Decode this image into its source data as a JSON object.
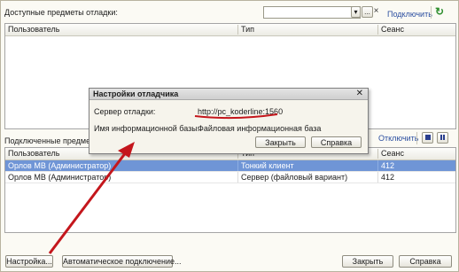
{
  "available": {
    "label": "Доступные предметы отладки:",
    "search_value": "",
    "dropdown_glyph": "▾",
    "more_glyph": "...",
    "clear_glyph": "×",
    "connect_link": "Подключить",
    "refresh_glyph": "↻",
    "columns": [
      "Пользователь",
      "Тип",
      "Сеанс"
    ]
  },
  "connected": {
    "label": "Подключенные предметы",
    "disconnect_link": "Отключить",
    "columns": [
      "Пользователь",
      "Тип",
      "Сеанс"
    ],
    "rows": [
      {
        "user": "Орлов МВ (Администратор)",
        "type": "Тонкий клиент",
        "session": "412",
        "selected": true
      },
      {
        "user": "Орлов МВ (Администратор)",
        "type": "Сервер (файловый вариант)",
        "session": "412",
        "selected": false
      }
    ]
  },
  "dialog": {
    "title": "Настройки отладчика",
    "close_glyph": "✕",
    "server_label": "Сервер отладки:",
    "server_value": "http://pc_koderline:1560",
    "infobase_label": "Имя информационной базы:",
    "infobase_value": "Файловая информационная база",
    "close_button": "Закрыть",
    "help_button": "Справка"
  },
  "footer": {
    "settings_button": "Настройка...",
    "auto_connect_button": "Автоматическое подключение...",
    "close_button": "Закрыть",
    "help_button": "Справка"
  },
  "colors": {
    "selection": "#6f95d6",
    "annotation": "#c4161c",
    "link": "#2c4fa0"
  }
}
